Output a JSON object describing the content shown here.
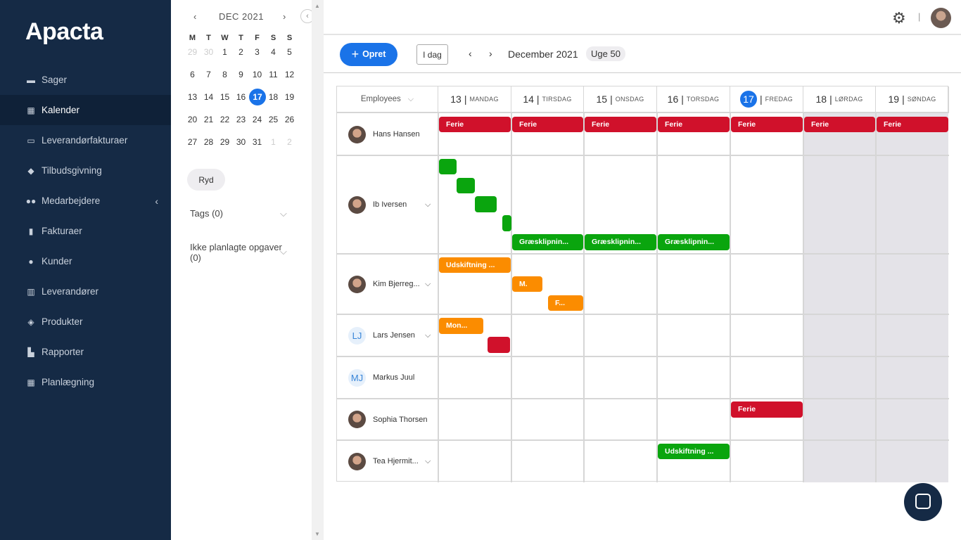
{
  "app": {
    "logo": "Apacta"
  },
  "sidebar": {
    "items": [
      {
        "label": "Sager",
        "icon": "folder-icon"
      },
      {
        "label": "Kalender",
        "icon": "calendar-icon"
      },
      {
        "label": "Leverandørfakturaer",
        "icon": "inbox-icon"
      },
      {
        "label": "Tilbudsgivning",
        "icon": "tag-icon"
      },
      {
        "label": "Medarbejdere",
        "icon": "users-icon"
      },
      {
        "label": "Fakturaer",
        "icon": "file-icon"
      },
      {
        "label": "Kunder",
        "icon": "user-icon"
      },
      {
        "label": "Leverandører",
        "icon": "building-icon"
      },
      {
        "label": "Produkter",
        "icon": "box-icon"
      },
      {
        "label": "Rapporter",
        "icon": "chart-icon"
      },
      {
        "label": "Planlægning",
        "icon": "calculator-icon"
      }
    ]
  },
  "mini_calendar": {
    "title": "DEC 2021",
    "prev": "‹",
    "next": "›",
    "dow": [
      "M",
      "T",
      "W",
      "T",
      "F",
      "S",
      "S"
    ],
    "days": [
      "29",
      "30",
      "1",
      "2",
      "3",
      "4",
      "5",
      "6",
      "7",
      "8",
      "9",
      "10",
      "11",
      "12",
      "13",
      "14",
      "15",
      "16",
      "17",
      "18",
      "19",
      "20",
      "21",
      "22",
      "23",
      "24",
      "25",
      "26",
      "27",
      "28",
      "29",
      "30",
      "31",
      "1",
      "2"
    ],
    "selected": "17",
    "clear": "Ryd",
    "tags": "Tags (0)",
    "unplanned": "Ikke planlagte opgaver (0)"
  },
  "toolbar": {
    "create": "Opret",
    "today": "I dag",
    "month": "December 2021",
    "week": "Uge 50"
  },
  "grid": {
    "employees_label": "Employees",
    "days": [
      {
        "num": "13",
        "name": "MANDAG"
      },
      {
        "num": "14",
        "name": "TIRSDAG"
      },
      {
        "num": "15",
        "name": "ONSDAG"
      },
      {
        "num": "16",
        "name": "TORSDAG"
      },
      {
        "num": "17",
        "name": "FREDAG"
      },
      {
        "num": "18",
        "name": "LØRDAG"
      },
      {
        "num": "19",
        "name": "SØNDAG"
      }
    ],
    "employees": [
      {
        "name": "Hans Hansen"
      },
      {
        "name": "Ib Iversen"
      },
      {
        "name": "Kim Bjerreg..."
      },
      {
        "name": "Lars Jensen",
        "initials": "LJ"
      },
      {
        "name": "Markus Juul",
        "initials": "MJ"
      },
      {
        "name": "Sophia Thorsen"
      },
      {
        "name": "Tea Hjermit..."
      }
    ],
    "events": {
      "ferie": "Ferie",
      "graes": "Græsklipnin...",
      "udsk": "Udskiftning ...",
      "m": "M.",
      "f": "F...",
      "mon": "Mon..."
    }
  },
  "colors": {
    "sidebar": "#152a45",
    "accent": "#1a73e8",
    "red": "#d0112b",
    "green": "#0aa50e",
    "orange": "#fb8c00"
  }
}
